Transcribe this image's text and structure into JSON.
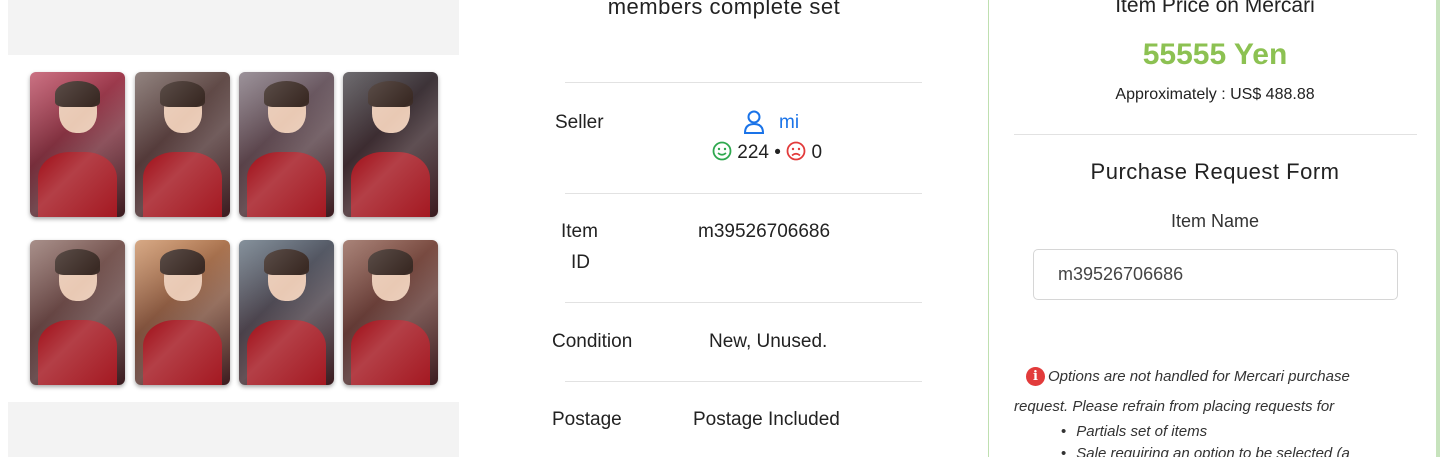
{
  "product": {
    "title_visible": "members complete set",
    "gallery": {
      "cards": [
        {
          "name": "photocard-1",
          "bg": "#b9435a"
        },
        {
          "name": "photocard-2",
          "bg": "#6d5a55"
        },
        {
          "name": "photocard-3",
          "bg": "#7b6e78"
        },
        {
          "name": "photocard-4",
          "bg": "#3e3b40"
        },
        {
          "name": "photocard-5",
          "bg": "#8b6a63"
        },
        {
          "name": "photocard-6",
          "bg": "#c98c5d"
        },
        {
          "name": "photocard-7",
          "bg": "#5d6c7a"
        },
        {
          "name": "photocard-8",
          "bg": "#8c5a4c"
        }
      ]
    }
  },
  "details": {
    "seller_label": "Seller",
    "seller_name": "mi",
    "positive_count": "224",
    "separator": "•",
    "negative_count": "0",
    "item_id_label_line1": "Item",
    "item_id_label_line2": "ID",
    "item_id": "m39526706686",
    "condition_label": "Condition",
    "condition": "New, Unused.",
    "postage_label": "Postage",
    "postage": "Postage Included"
  },
  "price_panel": {
    "heading": "Item Price on Mercari",
    "price": "55555 Yen",
    "approx": "Approximately : US$ 488.88"
  },
  "form": {
    "title": "Purchase Request Form",
    "item_name_label": "Item Name",
    "item_name_value": "m39526706686",
    "notice_line1": "Options are not handled for Mercari purchase",
    "notice_line2": "request. Please refrain from placing requests for",
    "bullets": [
      "Partials set of items",
      "Sale requiring an option to be selected (a"
    ]
  },
  "colors": {
    "accent_green": "#8cc152",
    "link_blue": "#1a73e8",
    "positive": "#2fa84f",
    "negative": "#e23b3b"
  },
  "icons": {
    "seller": "person-icon",
    "positive": "smile-icon",
    "negative": "frown-icon",
    "notice": "info-icon"
  }
}
